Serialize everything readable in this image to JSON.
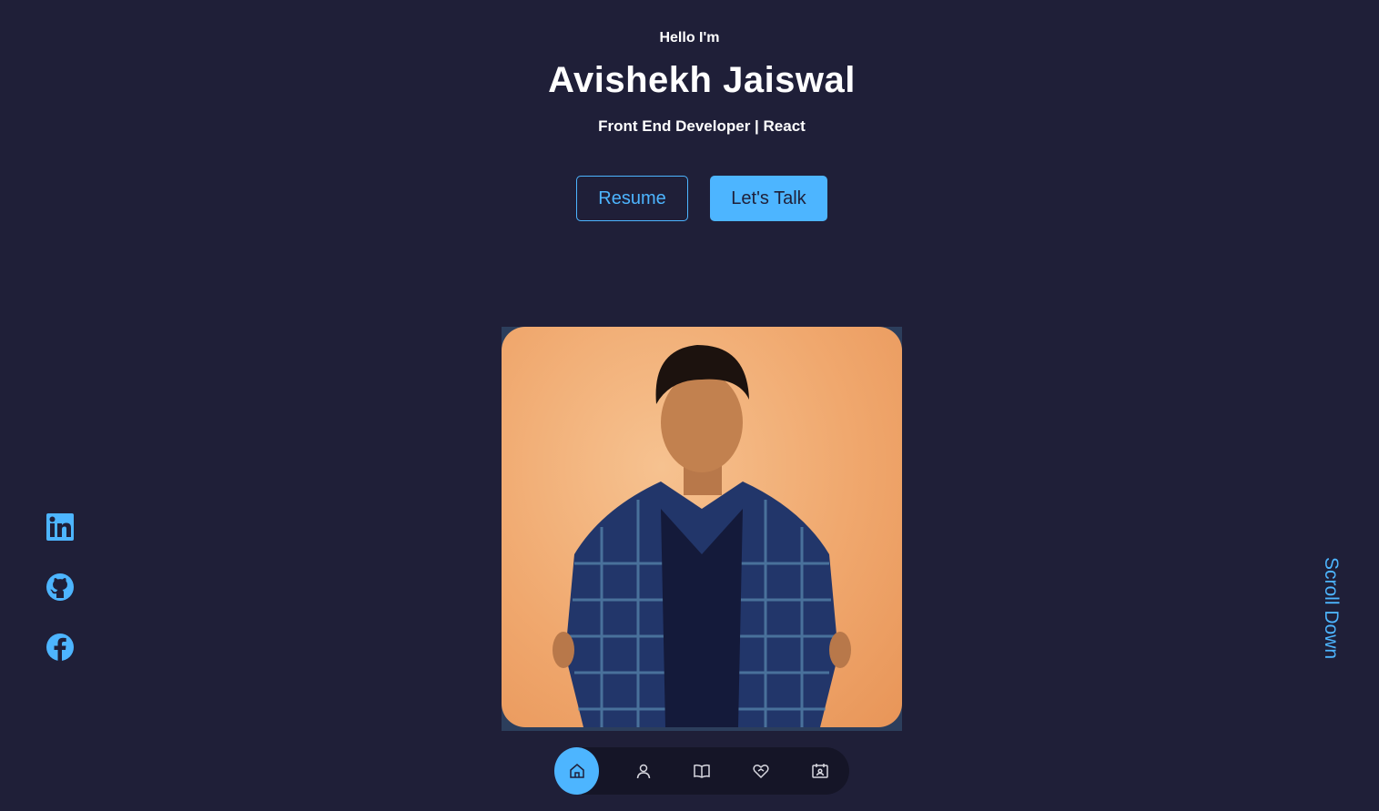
{
  "header": {
    "greeting": "Hello I'm",
    "name": "Avishekh Jaiswal",
    "role": "Front End Developer | React"
  },
  "cta": {
    "resume_label": "Resume",
    "talk_label": "Let's Talk"
  },
  "photo": {
    "icon": "profile-photo"
  },
  "socials": [
    {
      "icon": "linkedin-icon"
    },
    {
      "icon": "github-icon"
    },
    {
      "icon": "facebook-icon"
    }
  ],
  "scroll": {
    "label": "Scroll Down"
  },
  "nav": {
    "items": [
      {
        "icon": "home-icon",
        "active": true
      },
      {
        "icon": "user-icon",
        "active": false
      },
      {
        "icon": "book-icon",
        "active": false
      },
      {
        "icon": "services-icon",
        "active": false
      },
      {
        "icon": "contact-icon",
        "active": false
      }
    ]
  },
  "colors": {
    "background": "#1f1f38",
    "accent": "#4db5ff",
    "text": "#ffffff"
  }
}
